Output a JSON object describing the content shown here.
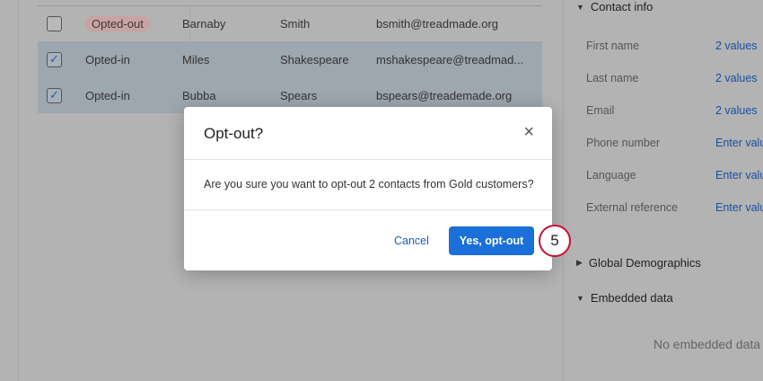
{
  "table": {
    "rows": [
      {
        "checked": false,
        "status": "Opted-out",
        "first": "Barnaby",
        "last": "Smith",
        "email": "bsmith@treadmade.org"
      },
      {
        "checked": true,
        "status": "Opted-in",
        "first": "Miles",
        "last": "Shakespeare",
        "email": "mshakespeare@treadmad..."
      },
      {
        "checked": true,
        "status": "Opted-in",
        "first": "Bubba",
        "last": "Spears",
        "email": "bspears@treademade.org"
      }
    ]
  },
  "panel": {
    "contact_info": "Contact info",
    "fields": [
      {
        "label": "First name",
        "value": "2 values"
      },
      {
        "label": "Last name",
        "value": "2 values"
      },
      {
        "label": "Email",
        "value": "2 values"
      },
      {
        "label": "Phone number",
        "value": "Enter value"
      },
      {
        "label": "Language",
        "value": "Enter value"
      },
      {
        "label": "External reference",
        "value": "Enter value"
      }
    ],
    "global_demographics": "Global Demographics",
    "embedded_data": "Embedded data",
    "no_embedded": "No embedded data"
  },
  "modal": {
    "title": "Opt-out?",
    "body": "Are you sure you want to opt-out 2 contacts from Gold customers?",
    "cancel": "Cancel",
    "confirm": "Yes, opt-out",
    "close_icon": "×"
  },
  "step_marker": "5"
}
